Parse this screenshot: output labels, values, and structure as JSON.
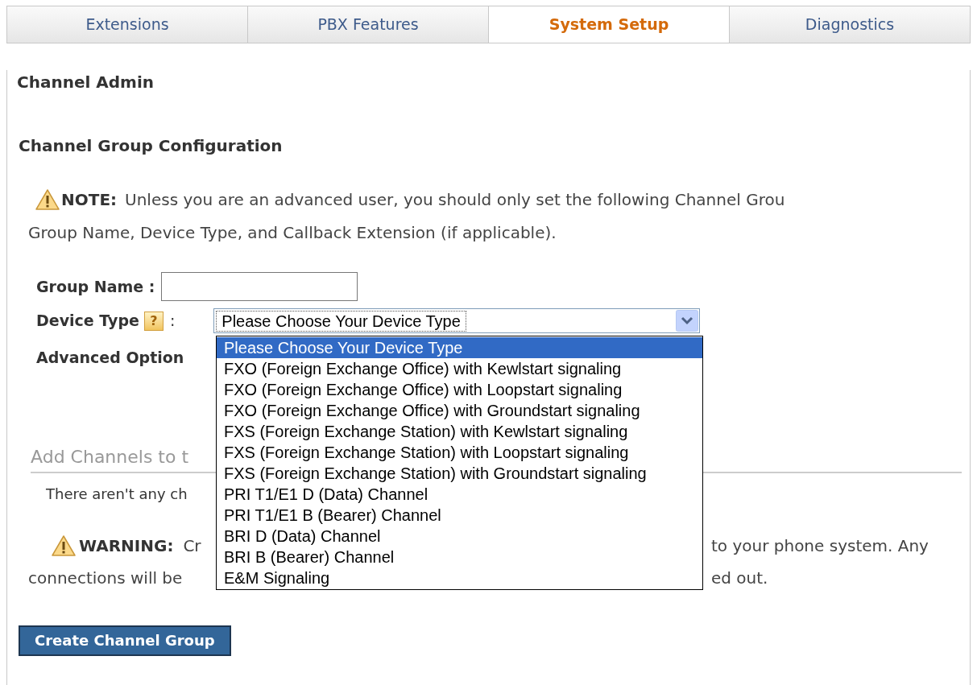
{
  "tabs": [
    {
      "label": "Extensions",
      "selected": false
    },
    {
      "label": "PBX Features",
      "selected": false
    },
    {
      "label": "System Setup",
      "selected": true
    },
    {
      "label": "Diagnostics",
      "selected": false
    }
  ],
  "page_title": "Channel Admin",
  "section_title": "Channel Group Configuration",
  "note": {
    "label": "NOTE:",
    "line_1": "Unless you are an advanced user, you should only set the following Channel Grou",
    "line_2": "Group Name, Device Type, and Callback Extension (if applicable)."
  },
  "group_name": {
    "label": "Group Name :"
  },
  "device_type": {
    "label": "Device Type",
    "help": "?",
    "separator": ":",
    "value": "Please Choose Your Device Type",
    "expanded": true,
    "options": [
      {
        "label": "Please Choose Your Device Type",
        "selected": true
      },
      {
        "label": "FXO (Foreign Exchange Office) with Kewlstart signaling",
        "selected": false
      },
      {
        "label": "FXO (Foreign Exchange Office) with Loopstart signaling",
        "selected": false
      },
      {
        "label": "FXO (Foreign Exchange Office) with Groundstart signaling",
        "selected": false
      },
      {
        "label": "FXS (Foreign Exchange Station) with Kewlstart signaling",
        "selected": false
      },
      {
        "label": "FXS (Foreign Exchange Station) with Loopstart signaling",
        "selected": false
      },
      {
        "label": "FXS (Foreign Exchange Station) with Groundstart signaling",
        "selected": false
      },
      {
        "label": "PRI T1/E1 D (Data) Channel",
        "selected": false
      },
      {
        "label": "PRI T1/E1 B (Bearer) Channel",
        "selected": false
      },
      {
        "label": "BRI D (Data) Channel",
        "selected": false
      },
      {
        "label": "BRI B (Bearer) Channel",
        "selected": false
      },
      {
        "label": "E&M Signaling",
        "selected": false
      }
    ]
  },
  "advanced_options": {
    "label": "Advanced Option"
  },
  "add_channels": {
    "heading": "Add Channels to t",
    "empty_text": "There aren't any ch"
  },
  "warning": {
    "label": "WARNING:",
    "line_1_start": "Cr",
    "line_1_end": "to your phone system. Any",
    "line_2_start": "connections will be",
    "line_2_end": "ed out."
  },
  "create_button": "Create Channel Group"
}
